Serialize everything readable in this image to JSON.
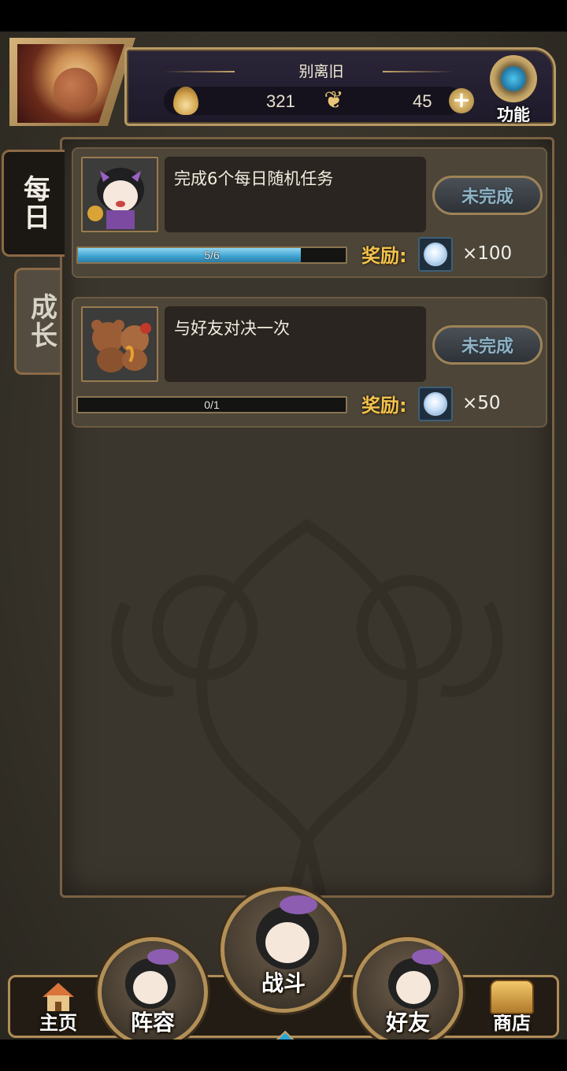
{
  "header": {
    "nickname": "别离旧",
    "currency_flame": "321",
    "currency_gem": "45",
    "function_label": "功能",
    "icons": [
      "flame-icon",
      "butterfly-icon",
      "plus-icon",
      "gear-icon"
    ]
  },
  "tabs": {
    "daily": "每日",
    "growth": "成长"
  },
  "tasks": [
    {
      "title": "完成6个每日随机任务",
      "status": "未完成",
      "progress_text": "5/6",
      "progress": 0.8333,
      "reward_label": "奖励:",
      "reward_amount": "×100"
    },
    {
      "title": "与好友对决一次",
      "status": "未完成",
      "progress_text": "0/1",
      "progress": 0,
      "reward_label": "奖励:",
      "reward_amount": "×50"
    }
  ],
  "nav": {
    "home": "主页",
    "team": "阵容",
    "battle": "战斗",
    "friends": "好友",
    "shop": "商店"
  },
  "colors": {
    "accent_gold": "#b99a66",
    "reward_gold": "#f2c24e",
    "progress_blue": "#3da2cf",
    "panel_bg": "#3b362d"
  }
}
